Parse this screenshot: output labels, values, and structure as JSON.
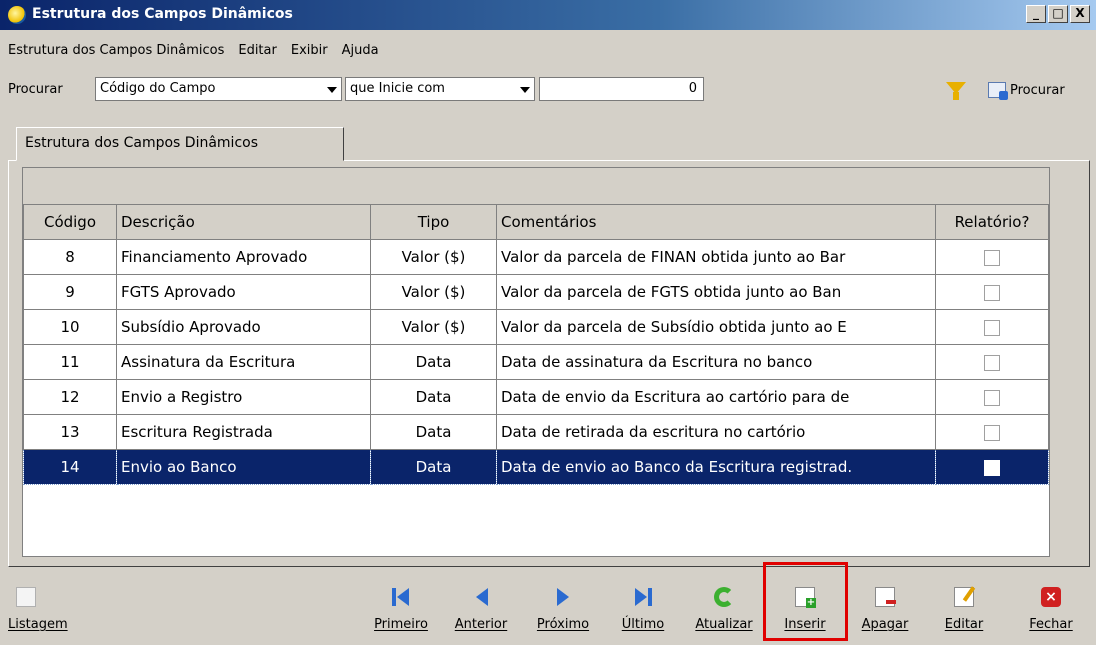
{
  "window": {
    "title": "Estrutura dos Campos Dinâmicos",
    "buttons": [
      "_",
      "□",
      "X"
    ]
  },
  "menu": [
    "Estrutura dos Campos Dinâmicos",
    "Editar",
    "Exibir",
    "Ajuda"
  ],
  "search": {
    "label": "Procurar",
    "field": "Código do Campo",
    "operator": "que Inicie com",
    "value": "0",
    "button": "Procurar",
    "filter_icon": "filter-funnel-icon"
  },
  "tab": {
    "label": "Estrutura dos Campos Dinâmicos"
  },
  "table": {
    "columns": [
      "Código",
      "Descrição",
      "Tipo",
      "Comentários",
      "Relatório?"
    ],
    "rows": [
      {
        "codigo": "8",
        "descricao": "Financiamento Aprovado",
        "tipo": "Valor ($)",
        "comentarios": "Valor da parcela de FINAN obtida junto ao Bar",
        "relatorio": false
      },
      {
        "codigo": "9",
        "descricao": "FGTS Aprovado",
        "tipo": "Valor ($)",
        "comentarios": "Valor da parcela de FGTS obtida junto ao Ban",
        "relatorio": false
      },
      {
        "codigo": "10",
        "descricao": "Subsídio Aprovado",
        "tipo": "Valor ($)",
        "comentarios": "Valor da parcela de Subsídio obtida junto ao E",
        "relatorio": false
      },
      {
        "codigo": "11",
        "descricao": "Assinatura da Escritura",
        "tipo": "Data",
        "comentarios": "Data de assinatura da Escritura no banco",
        "relatorio": false
      },
      {
        "codigo": "12",
        "descricao": "Envio a Registro",
        "tipo": "Data",
        "comentarios": "Data de envio da Escritura ao cartório para de",
        "relatorio": false
      },
      {
        "codigo": "13",
        "descricao": "Escritura Registrada",
        "tipo": "Data",
        "comentarios": "Data de retirada da escritura no cartório",
        "relatorio": false
      },
      {
        "codigo": "14",
        "descricao": "Envio ao Banco",
        "tipo": "Data",
        "comentarios": "Data de envio ao Banco da Escritura registrad.",
        "relatorio": false,
        "selected": true
      }
    ]
  },
  "toolbar": {
    "listagem": "Listagem",
    "primeiro": "Primeiro",
    "anterior": "Anterior",
    "proximo": "Próximo",
    "ultimo": "Último",
    "atualizar": "Atualizar",
    "inserir": "Inserir",
    "apagar": "Apagar",
    "editar": "Editar",
    "fechar": "Fechar"
  },
  "colors": {
    "title_bar": "#0a246a",
    "selection": "#0a246a",
    "highlight_box": "#e00000"
  }
}
